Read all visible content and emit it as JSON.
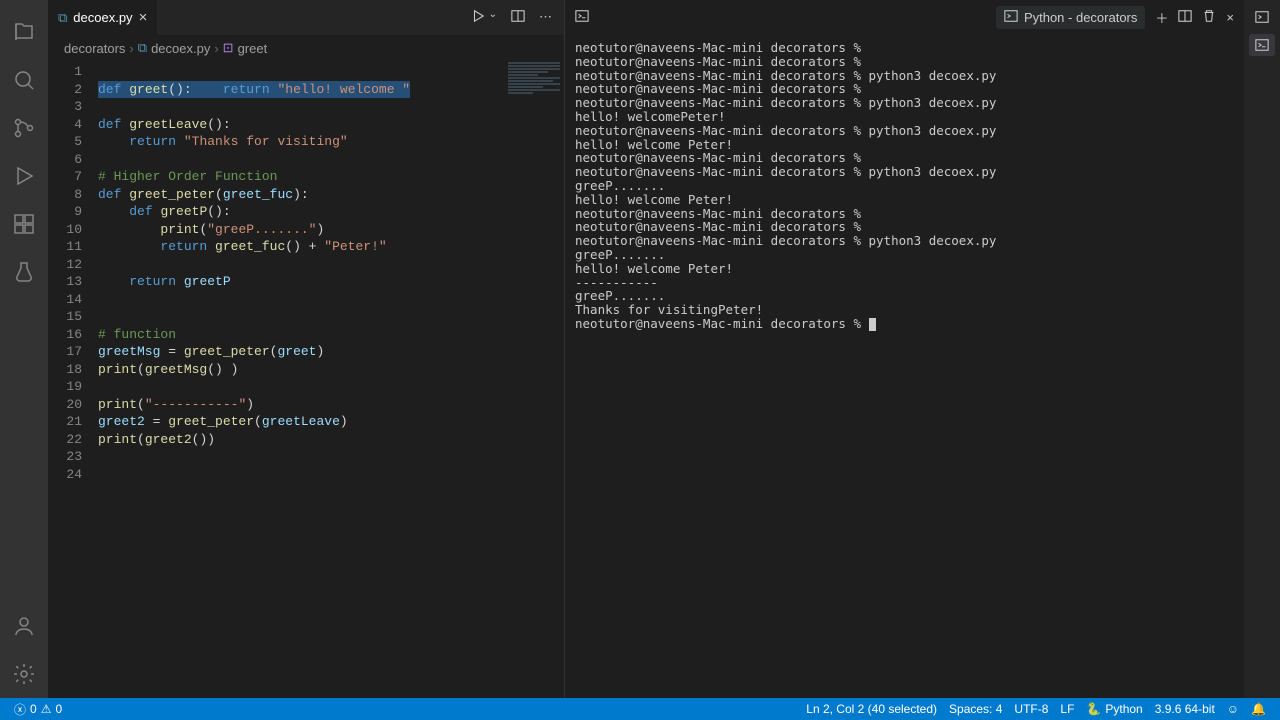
{
  "tab": {
    "filename": "decoex.py"
  },
  "breadcrumbs": {
    "folder": "decorators",
    "file": "decoex.py",
    "symbol": "greet"
  },
  "code": {
    "lines": [
      {
        "n": 1,
        "html": ""
      },
      {
        "n": 2,
        "html": "<span class='kw'>def</span> <span class='fn'>greet</span>():",
        "sel": true
      },
      {
        "n": 3,
        "html": "    <span class='kw'>return</span> <span class='str'>\"hello! welcome \"</span>",
        "sel": true
      },
      {
        "n": 4,
        "html": ""
      },
      {
        "n": 5,
        "html": "<span class='kw'>def</span> <span class='fn'>greetLeave</span>():"
      },
      {
        "n": 6,
        "html": "    <span class='kw'>return</span> <span class='str'>\"Thanks for visiting\"</span>"
      },
      {
        "n": 7,
        "html": ""
      },
      {
        "n": 8,
        "html": "<span class='cm'># Higher Order Function</span>"
      },
      {
        "n": 9,
        "html": "<span class='kw'>def</span> <span class='fn'>greet_peter</span>(<span class='id'>greet_fuc</span>):"
      },
      {
        "n": 10,
        "html": "    <span class='kw'>def</span> <span class='fn'>greetP</span>():"
      },
      {
        "n": 11,
        "html": "        <span class='fn'>print</span>(<span class='str'>\"greeP.......\"</span>)"
      },
      {
        "n": 12,
        "html": "        <span class='kw'>return</span> <span class='fn'>greet_fuc</span>() + <span class='str'>\"Peter!\"</span>"
      },
      {
        "n": 13,
        "html": ""
      },
      {
        "n": 14,
        "html": "    <span class='kw'>return</span> <span class='id'>greetP</span>"
      },
      {
        "n": 15,
        "html": ""
      },
      {
        "n": 16,
        "html": ""
      },
      {
        "n": 17,
        "html": "<span class='cm'># function</span>"
      },
      {
        "n": 18,
        "html": "<span class='id'>greetMsg</span> = <span class='fn'>greet_peter</span>(<span class='id'>greet</span>)"
      },
      {
        "n": 19,
        "html": "<span class='fn'>print</span>(<span class='fn'>greetMsg</span>() )"
      },
      {
        "n": 20,
        "html": ""
      },
      {
        "n": 21,
        "html": "<span class='fn'>print</span>(<span class='str'>\"-----------\"</span>)"
      },
      {
        "n": 22,
        "html": "<span class='id'>greet2</span> = <span class='fn'>greet_peter</span>(<span class='id'>greetLeave</span>)"
      },
      {
        "n": 23,
        "html": "<span class='fn'>print</span>(<span class='fn'>greet2</span>())"
      },
      {
        "n": 24,
        "html": ""
      }
    ]
  },
  "terminal": {
    "label": "Python - decorators",
    "lines": [
      "neotutor@naveens-Mac-mini decorators %",
      "neotutor@naveens-Mac-mini decorators %",
      "neotutor@naveens-Mac-mini decorators % python3 decoex.py",
      "neotutor@naveens-Mac-mini decorators %",
      "neotutor@naveens-Mac-mini decorators % python3 decoex.py",
      "hello! welcomePeter!",
      "neotutor@naveens-Mac-mini decorators % python3 decoex.py",
      "hello! welcome Peter!",
      "neotutor@naveens-Mac-mini decorators %",
      "neotutor@naveens-Mac-mini decorators % python3 decoex.py",
      "greeP.......",
      "hello! welcome Peter!",
      "neotutor@naveens-Mac-mini decorators %",
      "neotutor@naveens-Mac-mini decorators %",
      "neotutor@naveens-Mac-mini decorators % python3 decoex.py",
      "greeP.......",
      "hello! welcome Peter!",
      "-----------",
      "greeP.......",
      "Thanks for visitingPeter!",
      "neotutor@naveens-Mac-mini decorators % "
    ]
  },
  "status": {
    "errors": "0",
    "warnings": "0",
    "cursor": "Ln 2, Col 2 (40 selected)",
    "spaces": "Spaces: 4",
    "encoding": "UTF-8",
    "eol": "LF",
    "lang": "Python",
    "interpreter": "3.9.6 64-bit"
  }
}
